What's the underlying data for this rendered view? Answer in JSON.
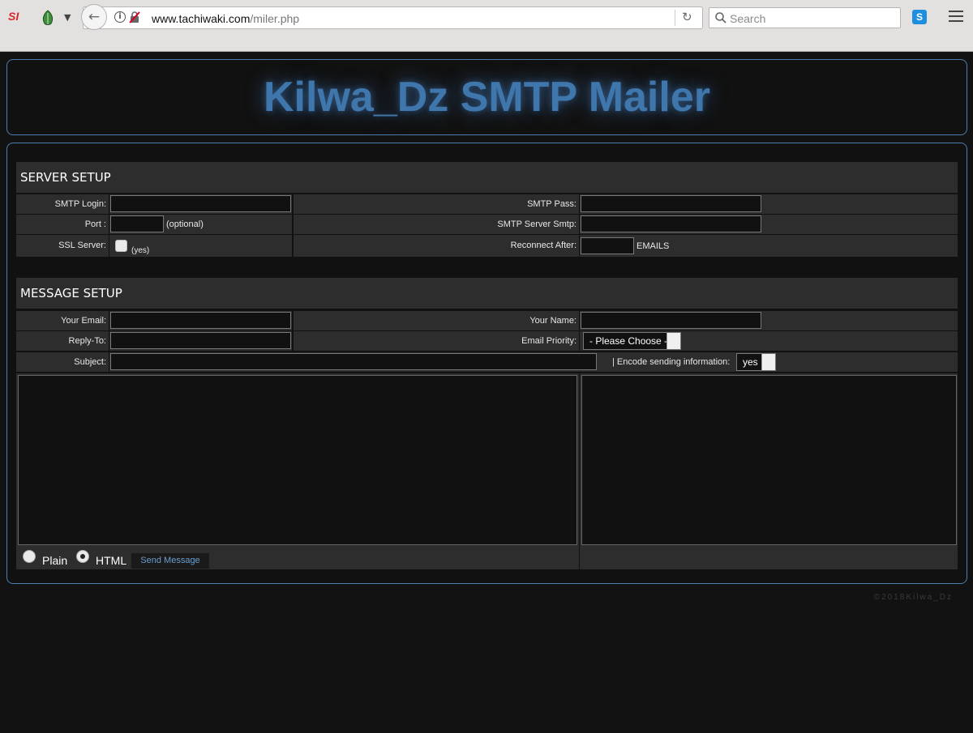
{
  "browser": {
    "url_domain": "www.tachiwaki.com",
    "url_path": "/miler.php",
    "search_placeholder": "Search",
    "ext_si_label": "SI",
    "skype_label": "S"
  },
  "header": {
    "title": "Kilwa_Dz SMTP Mailer"
  },
  "server_setup": {
    "heading": "SERVER SETUP",
    "smtp_login_label": "SMTP Login:",
    "smtp_login_value": "",
    "smtp_pass_label": "SMTP Pass:",
    "smtp_pass_value": "",
    "port_label": "Port :",
    "port_value": "",
    "port_note": "(optional)",
    "smtp_server_label": "SMTP Server Smtp:",
    "smtp_server_value": "",
    "ssl_label": "SSL Server:",
    "ssl_note": "(yes)",
    "ssl_checked": false,
    "reconnect_label": "Reconnect After:",
    "reconnect_value": "",
    "reconnect_unit": "EMAILS"
  },
  "message_setup": {
    "heading": "MESSAGE SETUP",
    "your_email_label": "Your Email:",
    "your_email_value": "",
    "your_name_label": "Your Name:",
    "your_name_value": "",
    "reply_to_label": "Reply-To:",
    "reply_to_value": "",
    "priority_label": "Email Priority:",
    "priority_selected": "- Please Choose -",
    "subject_label": "Subject:",
    "subject_value": "",
    "encode_label": "| Encode sending information:",
    "encode_selected": "yes",
    "message_body": "",
    "email_list": "",
    "format_plain_label": "Plain",
    "format_html_label": "HTML",
    "format_selected": "HTML",
    "send_label": "Send Message"
  },
  "footer": {
    "copyright": "©2018Kilwa_Dz"
  },
  "colors": {
    "accent": "#3f77ad",
    "panel_border": "#4c7fb0",
    "row_bg": "#2d2d2d",
    "page_bg": "#121212"
  }
}
